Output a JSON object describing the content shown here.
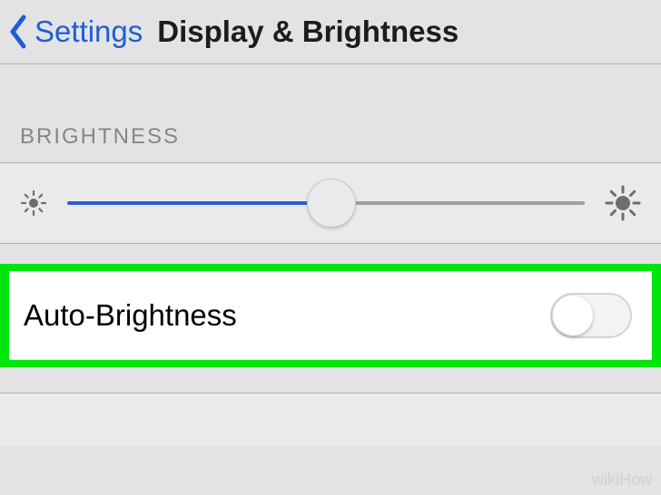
{
  "header": {
    "back_label": "Settings",
    "title": "Display & Brightness"
  },
  "brightness": {
    "section_header": "BRIGHTNESS",
    "slider_value_percent": 51
  },
  "auto": {
    "label": "Auto-Brightness",
    "enabled": false
  },
  "watermark": "wikiHow"
}
